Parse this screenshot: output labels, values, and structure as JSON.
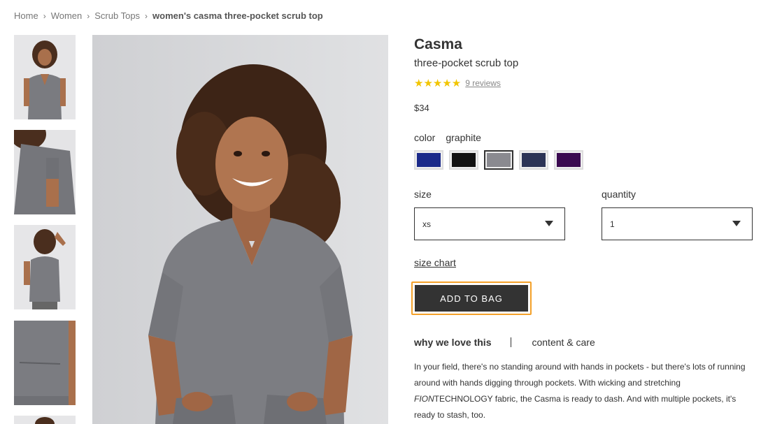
{
  "breadcrumb": {
    "items": [
      "Home",
      "Women",
      "Scrub Tops"
    ],
    "current": "women's casma three-pocket scrub top"
  },
  "product": {
    "name": "Casma",
    "subtitle": "three-pocket scrub top",
    "rating": 5,
    "stars": "★★★★★",
    "reviews": "9 reviews",
    "price": "$34"
  },
  "color": {
    "label": "color",
    "selected": "graphite",
    "swatches": [
      {
        "name": "navy",
        "hex": "#1b2a8a"
      },
      {
        "name": "black",
        "hex": "#121212"
      },
      {
        "name": "graphite",
        "hex": "#8a8a90"
      },
      {
        "name": "charcoal navy",
        "hex": "#2c3456"
      },
      {
        "name": "purple",
        "hex": "#3a0a50"
      }
    ]
  },
  "size": {
    "label": "size",
    "value": "xs"
  },
  "quantity": {
    "label": "quantity",
    "value": "1"
  },
  "size_chart": "size chart",
  "add_to_bag": "ADD TO BAG",
  "tabs": {
    "active": "why we love this",
    "other": "content & care"
  },
  "description": {
    "before": "In your field, there's no standing around with hands in pockets - but there's lots of running around with hands digging through pockets. With wicking and stretching ",
    "brand": "FION",
    "after": "TECHNOLOGY fabric, the Casma is ready to dash. And with multiple pockets, it's ready to stash, too."
  },
  "colors": {
    "accent": "#f4a12a",
    "button": "#333333",
    "star": "#f2c500"
  }
}
